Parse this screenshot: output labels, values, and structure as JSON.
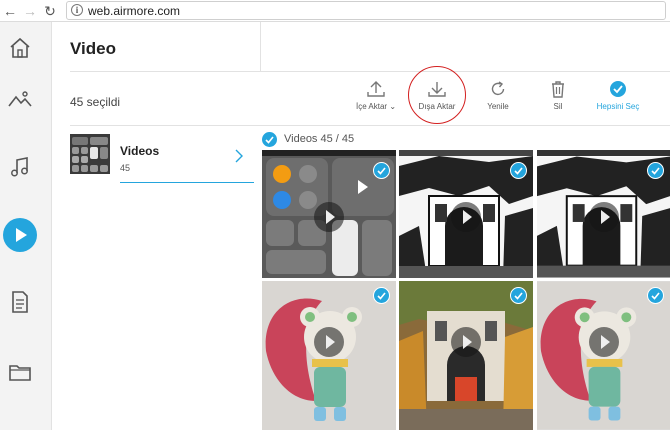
{
  "browser": {
    "url": "web.airmore.com",
    "back_icon": "arrow-left-icon",
    "forward_icon": "arrow-right-icon",
    "reload_icon": "reload-icon",
    "info_glyph": "i"
  },
  "sidebar": {
    "items": [
      {
        "name": "home-icon"
      },
      {
        "name": "photos-icon"
      },
      {
        "name": "music-icon"
      },
      {
        "name": "video-icon",
        "active": true
      },
      {
        "name": "documents-icon"
      },
      {
        "name": "files-icon"
      }
    ]
  },
  "header": {
    "title": "Video"
  },
  "toolbar": {
    "selected_count": "45 seçildi",
    "import_label": "İçe Aktar",
    "export_label": "Dışa Aktar",
    "refresh_label": "Yenile",
    "delete_label": "Sil",
    "select_all_label": "Hepsini Seç"
  },
  "album": {
    "name": "Videos",
    "count": "45"
  },
  "grid": {
    "title": "Videos   45 / 45"
  },
  "colors": {
    "accent": "#24a5dd",
    "highlight_ring": "#d32020",
    "sidebar_bg": "#f3f3f3"
  }
}
